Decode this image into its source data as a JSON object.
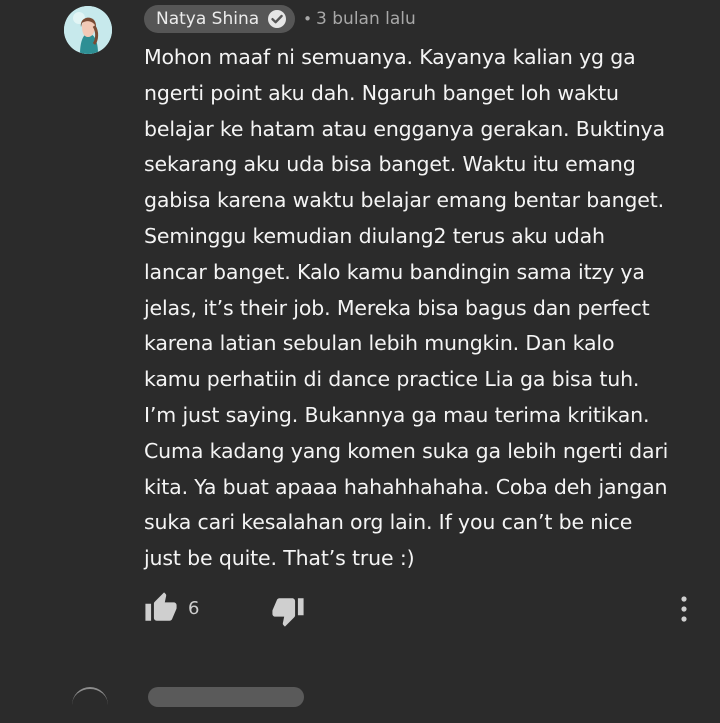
{
  "comment": {
    "author": "Natya Shina",
    "verified_icon": "verified-check-icon",
    "separator": "•",
    "timestamp": "3 bulan lalu",
    "text_lines": [
      "Mohon maaf ni semuanya. Kayanya kalian yg ga",
      "ngerti point aku dah. Ngaruh banget loh waktu",
      "belajar ke hatam atau engganya gerakan. Buktinya",
      "sekarang aku uda bisa banget. Waktu itu emang",
      "gabisa karena waktu belajar emang bentar banget.",
      "Seminggu kemudian diulang2 terus aku udah",
      "lancar banget. Kalo kamu bandingin sama itzy ya",
      "jelas, it’s their job. Mereka bisa bagus dan perfect",
      "karena latian sebulan lebih mungkin. Dan kalo",
      "kamu perhatiin di dance practice Lia ga bisa tuh.",
      "I’m just saying. Bukannya ga mau terima kritikan.",
      "Cuma kadang yang komen suka ga lebih ngerti dari",
      "kita. Ya buat apaaa hahahhahaha. Coba deh jangan",
      "suka cari kesalahan org lain. If you can’t be nice",
      "just be quite. That’s true :)"
    ],
    "likes": "6",
    "icons": {
      "like": "thumbs-up-icon",
      "dislike": "thumbs-down-icon",
      "more": "more-vertical-icon"
    }
  },
  "colors": {
    "background": "#2b2b2b",
    "text": "#f4f4f4",
    "secondary_text": "#a8a8a8",
    "chip": "#565656",
    "icon": "#cfcfcf"
  }
}
